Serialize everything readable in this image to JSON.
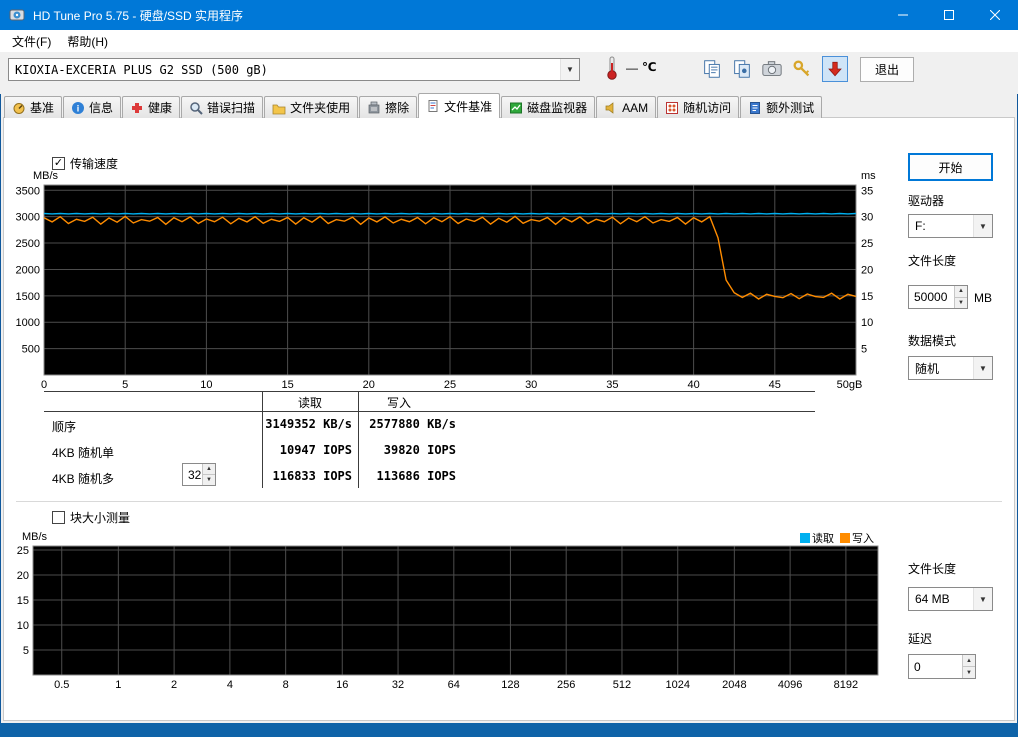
{
  "accent_color": "#0078d7",
  "window": {
    "title": "HD Tune Pro 5.75 - 硬盘/SSD 实用程序"
  },
  "menu": {
    "file": "文件(F)",
    "help": "帮助(H)"
  },
  "toolbar": {
    "drive_select": "KIOXIA-EXCERIA PLUS G2 SSD (500 gB)",
    "temperature_value": "—",
    "temperature_unit": "℃",
    "exit_label": "退出"
  },
  "tabs": [
    {
      "label": "基准"
    },
    {
      "label": "信息"
    },
    {
      "label": "健康"
    },
    {
      "label": "错误扫描"
    },
    {
      "label": "文件夹使用"
    },
    {
      "label": "擦除"
    },
    {
      "label": "文件基准",
      "active": true
    },
    {
      "label": "磁盘监视器"
    },
    {
      "label": "AAM"
    },
    {
      "label": "随机访问"
    },
    {
      "label": "额外测试"
    }
  ],
  "file_benchmark": {
    "transfer_speed_label": "传输速度",
    "transfer_speed_checked": true,
    "start_button": "开始",
    "drive_label": "驱动器",
    "drive_value": "F:",
    "file_length_label": "文件长度",
    "file_length_value": "50000",
    "file_length_unit": "MB",
    "data_mode_label": "数据模式",
    "data_mode_value": "随机",
    "results": {
      "col_read": "读取",
      "col_write": "写入",
      "rows": [
        {
          "label": "顺序",
          "read": "3149352 KB/s",
          "write": "2577880 KB/s"
        },
        {
          "label": "4KB 随机单",
          "read": "10947 IOPS",
          "write": "39820 IOPS"
        },
        {
          "label": "4KB 随机多",
          "queue_depth": "32",
          "read": "116833 IOPS",
          "write": "113686 IOPS"
        }
      ]
    }
  },
  "block_size": {
    "checkbox_label": "块大小测量",
    "checkbox_checked": false,
    "legend": [
      {
        "label": "读取",
        "color": "#00b0f0"
      },
      {
        "label": "写入",
        "color": "#ff8c00"
      }
    ],
    "file_length_label": "文件长度",
    "file_length_value": "64 MB",
    "delay_label": "延迟",
    "delay_value": "0"
  },
  "chart_data": [
    {
      "type": "line",
      "title": "传输速度",
      "ylabel_left": "MB/s",
      "ylabel_right": "ms",
      "xlim": [
        0,
        50
      ],
      "ylim_left": [
        0,
        3600
      ],
      "yticks_left": [
        500,
        1000,
        1500,
        2000,
        2500,
        3000,
        3500
      ],
      "ylim_right": [
        0,
        36
      ],
      "yticks_right": [
        5,
        10,
        15,
        20,
        25,
        30,
        35
      ],
      "x_ticks": [
        {
          "label": "0",
          "frac": 0,
          "grid": false
        },
        {
          "label": "5",
          "frac": 0.1,
          "grid": true
        },
        {
          "label": "10",
          "frac": 0.2,
          "grid": true
        },
        {
          "label": "15",
          "frac": 0.3,
          "grid": true
        },
        {
          "label": "20",
          "frac": 0.4,
          "grid": true
        },
        {
          "label": "25",
          "frac": 0.5,
          "grid": true
        },
        {
          "label": "30",
          "frac": 0.6,
          "grid": true
        },
        {
          "label": "35",
          "frac": 0.7,
          "grid": true
        },
        {
          "label": "40",
          "frac": 0.8,
          "grid": true
        },
        {
          "label": "45",
          "frac": 0.9,
          "grid": true
        },
        {
          "label": "50gB",
          "frac": 0.992,
          "grid": false
        }
      ],
      "grid": true,
      "plot_bg": "#000000",
      "grid_color": "#4d4d4d",
      "series": [
        {
          "name": "写入",
          "color": "#ff8c00",
          "x_start": 0,
          "x_step": 0.5,
          "y": [
            2980,
            2900,
            3000,
            2870,
            2950,
            2910,
            2990,
            2860,
            2975,
            2895,
            3005,
            2880,
            2945,
            2915,
            2985,
            2855,
            2980,
            2905,
            2995,
            2870,
            2955,
            2905,
            2990,
            2865,
            2970,
            2900,
            3000,
            2875,
            2950,
            2910,
            2985,
            2860,
            2980,
            2895,
            3005,
            2870,
            2945,
            2915,
            2990,
            2855,
            2975,
            2900,
            2995,
            2880,
            2950,
            2905,
            2985,
            2865,
            2980,
            2905,
            3000,
            2870,
            2955,
            2910,
            2990,
            2860,
            2970,
            2895,
            3005,
            2875,
            2945,
            2915,
            2985,
            2855,
            2980,
            2900,
            2995,
            2870,
            2950,
            2905,
            2990,
            2865,
            2975,
            2905,
            3000,
            2880,
            2945,
            2910,
            2985,
            2860,
            2980,
            2900,
            3000,
            2600,
            1800,
            1560,
            1470,
            1550,
            1440,
            1530,
            1490,
            1465,
            1545,
            1445,
            1535,
            1485,
            1470,
            1550,
            1440,
            1530,
            1490
          ]
        },
        {
          "name": "读取",
          "color": "#00b0f0",
          "x_start": 0,
          "x_step": 0.5,
          "count": 101,
          "y_pattern": [
            3060,
            3052
          ]
        }
      ]
    },
    {
      "type": "line",
      "title": "块大小测量",
      "ylabel_left": "MB/s",
      "xlim": [
        0,
        1
      ],
      "ylim_left": [
        0,
        25.8
      ],
      "yticks_left": [
        5,
        10,
        15,
        20,
        25
      ],
      "x_ticks": [
        {
          "label": "0.5",
          "frac": 0.034,
          "grid": true
        },
        {
          "label": "1",
          "frac": 0.101,
          "grid": true
        },
        {
          "label": "2",
          "frac": 0.167,
          "grid": true
        },
        {
          "label": "4",
          "frac": 0.233,
          "grid": true
        },
        {
          "label": "8",
          "frac": 0.299,
          "grid": true
        },
        {
          "label": "16",
          "frac": 0.366,
          "grid": true
        },
        {
          "label": "32",
          "frac": 0.432,
          "grid": true
        },
        {
          "label": "64",
          "frac": 0.498,
          "grid": true
        },
        {
          "label": "128",
          "frac": 0.565,
          "grid": true
        },
        {
          "label": "256",
          "frac": 0.631,
          "grid": true
        },
        {
          "label": "512",
          "frac": 0.697,
          "grid": true
        },
        {
          "label": "1024",
          "frac": 0.763,
          "grid": true
        },
        {
          "label": "2048",
          "frac": 0.83,
          "grid": true
        },
        {
          "label": "4096",
          "frac": 0.896,
          "grid": true
        },
        {
          "label": "8192",
          "frac": 0.962,
          "grid": true
        }
      ],
      "grid": true,
      "plot_bg": "#000000",
      "grid_color": "#4d4d4d",
      "series": []
    }
  ]
}
